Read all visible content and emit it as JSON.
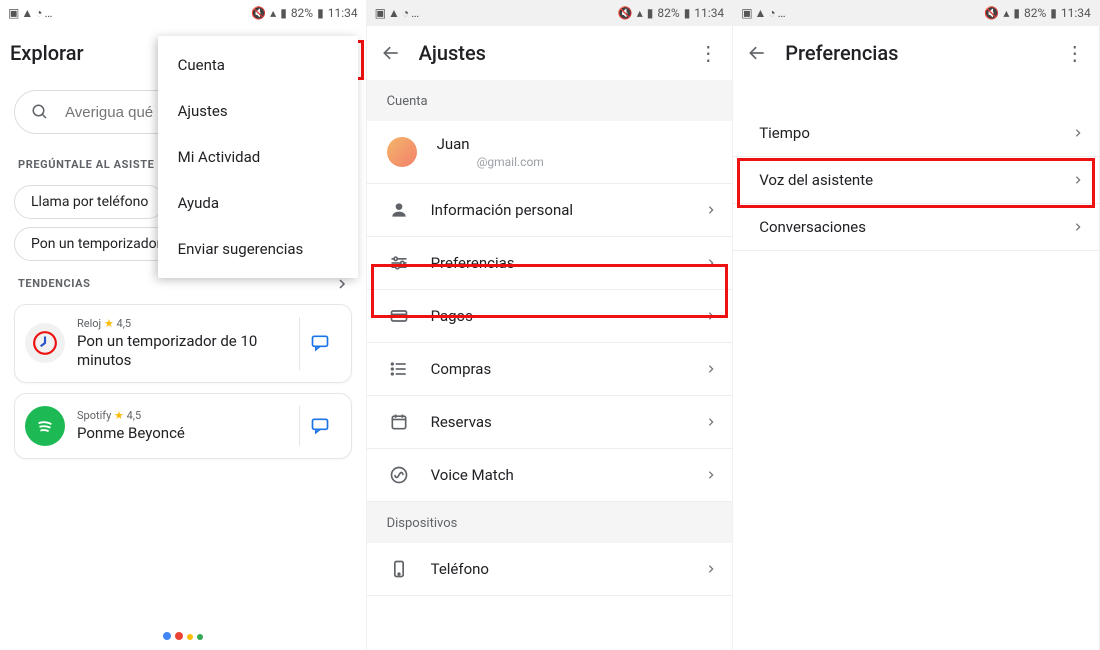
{
  "status": {
    "battery": "82%",
    "time": "11:34"
  },
  "panel1": {
    "title": "Explorar",
    "search_placeholder": "Averigua qué",
    "ask_label": "PREGÚNTALE AL ASISTE",
    "chips": [
      "Llama por teléfono",
      "Pon un temporizador"
    ],
    "trend_label": "TENDENCIAS",
    "cards": [
      {
        "app": "Reloj",
        "rating": "4,5",
        "title": "Pon un temporizador de 10 minutos"
      },
      {
        "app": "Spotify",
        "rating": "4,5",
        "title": "Ponme Beyoncé"
      }
    ],
    "menu": [
      "Cuenta",
      "Ajustes",
      "Mi Actividad",
      "Ayuda",
      "Enviar sugerencias"
    ]
  },
  "panel2": {
    "title": "Ajustes",
    "cat_account": "Cuenta",
    "user_name": "Juan",
    "user_email": "@gmail.com",
    "rows": [
      {
        "label": "Información personal"
      },
      {
        "label": "Preferencias"
      },
      {
        "label": "Pagos"
      },
      {
        "label": "Compras"
      },
      {
        "label": "Reservas"
      },
      {
        "label": "Voice Match"
      }
    ],
    "cat_devices": "Dispositivos",
    "row_phone": "Teléfono"
  },
  "panel3": {
    "title": "Preferencias",
    "rows": [
      {
        "label": "Tiempo"
      },
      {
        "label": "Voz del asistente"
      },
      {
        "label": "Conversaciones"
      }
    ]
  }
}
